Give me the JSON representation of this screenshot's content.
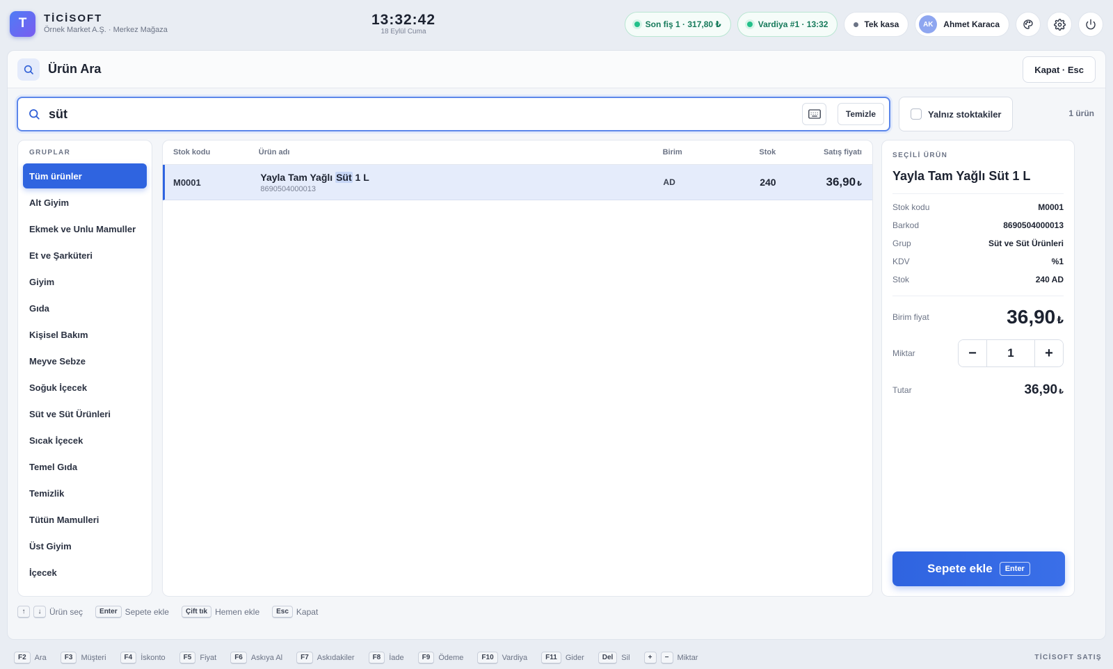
{
  "app": {
    "logo_letter": "T",
    "name": "TİCİSOFT",
    "subtitle": "Örnek Market A.Ş. · Merkez Mağaza",
    "time": "13:32:42",
    "date": "18 Eylül Cuma"
  },
  "status": {
    "last_receipt": "Son fiş 1 · 317,80 ₺",
    "shift": "Vardiya #1 · 13:32",
    "register": "Tek kasa",
    "user_initials": "AK",
    "user_name": "Ahmet Karaca"
  },
  "dialog": {
    "title": "Ürün Ara",
    "close_label": "Kapat · Esc"
  },
  "search": {
    "value": "süt",
    "clear_label": "Temizle",
    "stock_only_label": "Yalnız stoktakiler",
    "result_count": "1 ürün"
  },
  "groups": {
    "title": "GRUPLAR",
    "items": [
      "Tüm ürünler",
      "Alt Giyim",
      "Ekmek ve Unlu Mamuller",
      "Et ve Şarküteri",
      "Giyim",
      "Gıda",
      "Kişisel Bakım",
      "Meyve Sebze",
      "Soğuk İçecek",
      "Süt ve Süt Ürünleri",
      "Sıcak İçecek",
      "Temel Gıda",
      "Temizlik",
      "Tütün Mamulleri",
      "Üst Giyim",
      "İçecek"
    ],
    "active_index": 0
  },
  "table": {
    "headers": {
      "code": "Stok kodu",
      "name": "Ürün adı",
      "unit": "Birim",
      "stock": "Stok",
      "price": "Satış fiyatı"
    },
    "rows": [
      {
        "code": "M0001",
        "name_pre": "Yayla Tam Yağlı ",
        "name_hl": "Süt",
        "name_post": " 1 L",
        "barcode": "8690504000013",
        "unit": "AD",
        "stock": "240",
        "price": "36,90",
        "currency": "₺"
      }
    ]
  },
  "detail": {
    "label": "SEÇİLİ ÜRÜN",
    "title": "Yayla Tam Yağlı Süt 1 L",
    "fields": [
      {
        "k": "Stok kodu",
        "v": "M0001"
      },
      {
        "k": "Barkod",
        "v": "8690504000013"
      },
      {
        "k": "Grup",
        "v": "Süt ve Süt Ürünleri"
      },
      {
        "k": "KDV",
        "v": "%1"
      },
      {
        "k": "Stok",
        "v": "240 AD"
      }
    ],
    "unit_price_label": "Birim fiyat",
    "unit_price": "36,90",
    "currency": "₺",
    "qty_label": "Miktar",
    "qty": "1",
    "minus": "−",
    "plus": "+",
    "total_label": "Tutar",
    "total": "36,90",
    "add_label": "Sepete ekle",
    "add_key": "Enter"
  },
  "hints": {
    "up": "↑",
    "down": "↓",
    "select": "Ürün seç",
    "enter_key": "Enter",
    "enter_text": "Sepete ekle",
    "dbl_key": "Çift tık",
    "dbl_text": "Hemen ekle",
    "esc_key": "Esc",
    "esc_text": "Kapat"
  },
  "fkeys": [
    {
      "key": "F2",
      "label": "Ara"
    },
    {
      "key": "F3",
      "label": "Müşteri"
    },
    {
      "key": "F4",
      "label": "İskonto"
    },
    {
      "key": "F5",
      "label": "Fiyat"
    },
    {
      "key": "F6",
      "label": "Askıya Al"
    },
    {
      "key": "F7",
      "label": "Askıdakiler"
    },
    {
      "key": "F8",
      "label": "İade"
    },
    {
      "key": "F9",
      "label": "Ödeme"
    },
    {
      "key": "F10",
      "label": "Vardiya"
    },
    {
      "key": "F11",
      "label": "Gider"
    },
    {
      "key": "Del",
      "label": "Sil"
    }
  ],
  "qty_keys": {
    "plus": "+",
    "minus": "−",
    "label": "Miktar"
  },
  "footer_brand": "TİCİSOFT SATIŞ",
  "colors": {
    "accent": "#2f64e0",
    "success": "#22c08a",
    "background": "#e9edf3"
  }
}
